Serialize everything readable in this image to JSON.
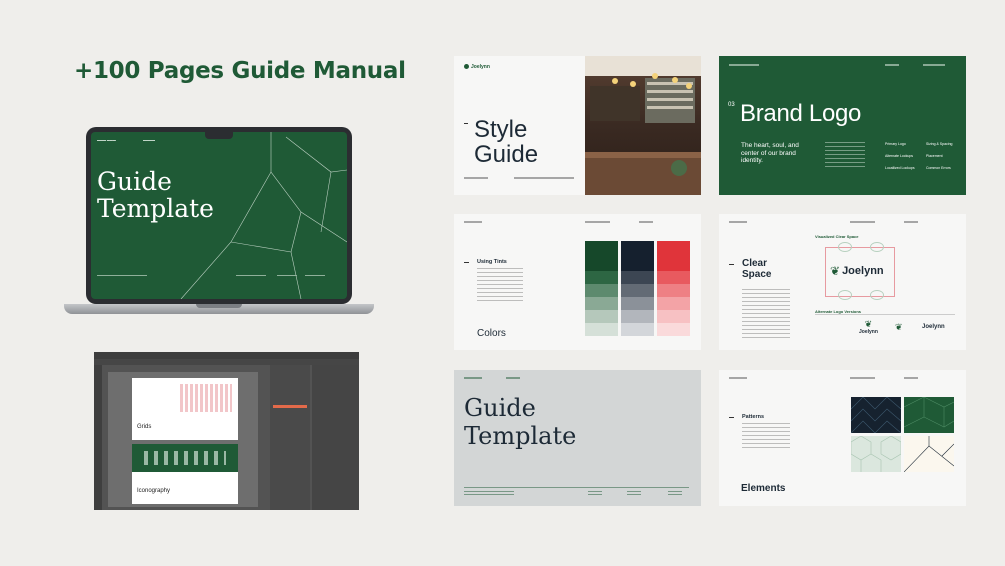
{
  "headline": "+100 Pages Guide Manual",
  "laptop": {
    "title_line1": "Guide",
    "title_line2": "Template"
  },
  "editor": {
    "page1_label": "Grids",
    "page2_label": "Iconography"
  },
  "style_guide": {
    "brand": "Joelynn",
    "title_line1": "Style",
    "title_line2": "Guide"
  },
  "brand_logo": {
    "number": "03",
    "title": "Brand Logo",
    "tagline": "The heart, soul, and center of our brand identity.",
    "labels": [
      "Primary Logo",
      "Sizing & Spacing",
      "Alternate Lockups",
      "Placement",
      "Locallized Lockups",
      "Common Errors"
    ]
  },
  "colors": {
    "subtitle": "Using Tints",
    "title": "Colors",
    "palettes": [
      [
        "#16482a",
        "#2d6643",
        "#5d8a6e",
        "#8aa995",
        "#b5c8bb",
        "#d5e0d8"
      ],
      [
        "#15202e",
        "#3c4653",
        "#636b75",
        "#8b9199",
        "#b2b6bc",
        "#d3d6da"
      ],
      [
        "#e0343a",
        "#e85a5f",
        "#ee8084",
        "#f3a3a6",
        "#f7c1c3",
        "#fadadb"
      ]
    ]
  },
  "clear_space": {
    "title_line1": "Clear",
    "title_line2": "Space",
    "visualized_label": "Visualized Clear Space",
    "logo_text": "Joelynn",
    "alternate_label": "Alternate Logo Versions",
    "alt_logo_1": "Joelynn",
    "alt_logo_2": "Joelynn"
  },
  "guide_template": {
    "title_line1": "Guide",
    "title_line2": "Template"
  },
  "patterns": {
    "subtitle": "Patterns",
    "title": "Elements"
  }
}
